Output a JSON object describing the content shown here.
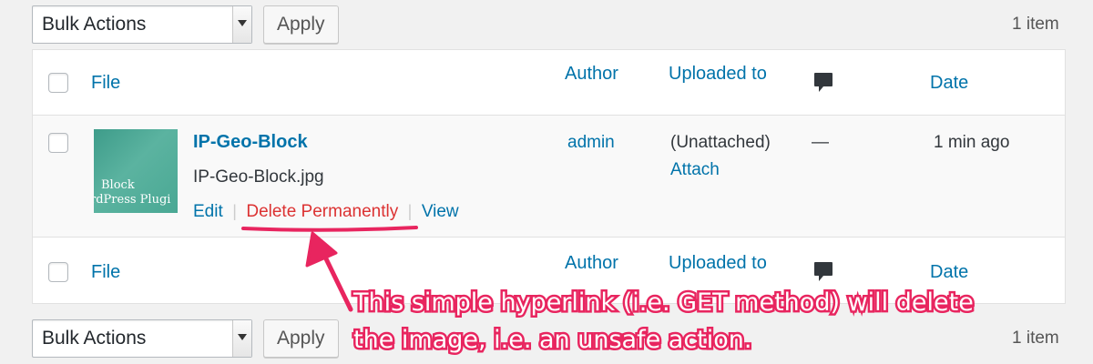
{
  "top_bar": {
    "bulk_select": "Bulk Actions",
    "apply_label": "Apply",
    "item_count": "1 item"
  },
  "table": {
    "columns": {
      "file": "File",
      "author": "Author",
      "uploaded_to": "Uploaded to",
      "comments_icon": "comment-bubble-icon",
      "date": "Date"
    },
    "row": {
      "title": "IP-Geo-Block",
      "filename": "IP-Geo-Block.jpg",
      "thumbnail_text_line1": "Block",
      "thumbnail_text_line2": "rdPress Plugi",
      "actions": {
        "edit": "Edit",
        "separator": "|",
        "delete": "Delete Permanently",
        "view": "View"
      },
      "author": "admin",
      "uploaded_to": "(Unattached)",
      "attach": "Attach",
      "comments": "—",
      "date": "1 min ago"
    }
  },
  "bottom_bar": {
    "bulk_select": "Bulk Actions",
    "apply_label": "Apply",
    "item_count": "1 item"
  },
  "annotation": {
    "line1": "This simple hyperlink (i.e. GET method) will delete",
    "line2": "the image, i.e. an unsafe action.",
    "color": "#e8255f"
  }
}
